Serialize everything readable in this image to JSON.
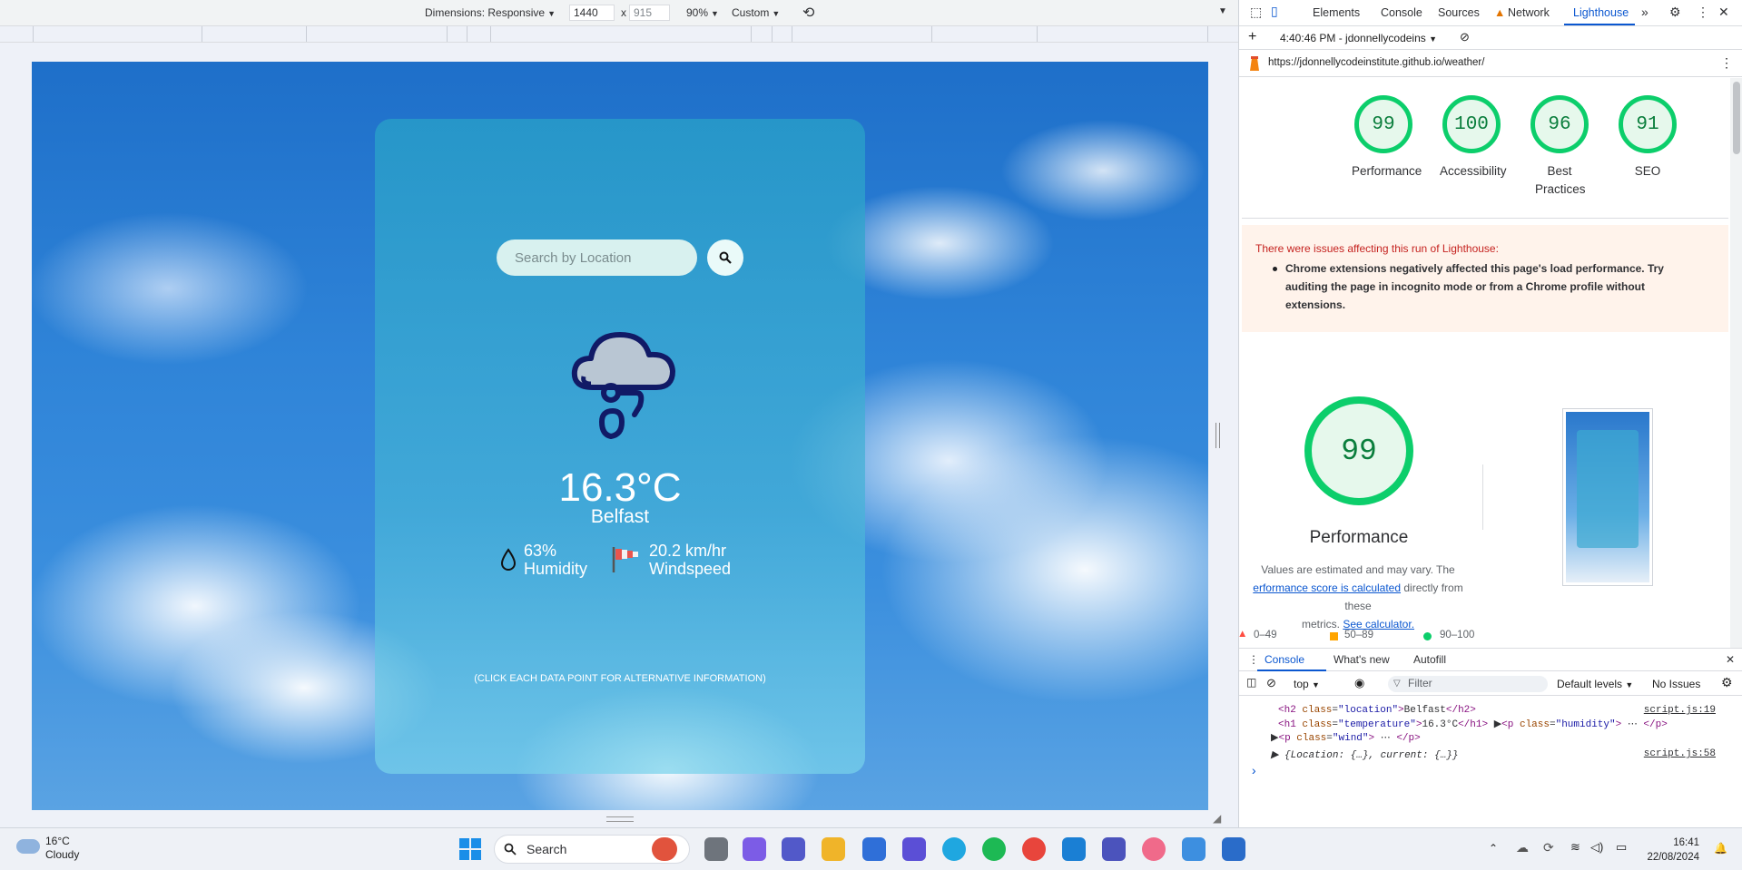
{
  "device_toolbar": {
    "dimensions_label": "Dimensions: Responsive",
    "width": "1440",
    "times": "x",
    "height": "915",
    "zoom": "90%",
    "throttle": "Custom"
  },
  "app": {
    "search_placeholder": "Search by Location",
    "temperature": "16.3°C",
    "location": "Belfast",
    "humidity_value": "63%",
    "humidity_label": "Humidity",
    "wind_value": "20.2 km/hr",
    "wind_label": "Windspeed",
    "hint": "(CLICK EACH DATA POINT FOR ALTERNATIVE INFORMATION)"
  },
  "devtools": {
    "tabs": [
      "Elements",
      "Console",
      "Sources",
      "Network",
      "Lighthouse"
    ],
    "report_time": "4:40:46 PM - jdonnellycodeins",
    "url": "https://jdonnellycodeinstitute.github.io/weather/",
    "scores": [
      {
        "value": "99",
        "label": "Performance"
      },
      {
        "value": "100",
        "label": "Accessibility"
      },
      {
        "value": "96",
        "label": "Best Practices"
      },
      {
        "value": "91",
        "label": "SEO"
      }
    ],
    "issues_heading": "There were issues affecting this run of Lighthouse:",
    "issues_item": "Chrome extensions negatively affected this page's load performance. Try auditing the page in incognito mode or from a Chrome profile without extensions.",
    "perf_score": "99",
    "perf_title": "Performance",
    "perf_note_1": "Values are estimated and may vary. The",
    "perf_note_link": "erformance score is calculated",
    "perf_note_2": "directly from these",
    "perf_note_3": "metrics.",
    "perf_note_link2": "See calculator.",
    "legend": [
      "0–49",
      "50–89",
      "90–100"
    ],
    "drawer_tabs": [
      "Console",
      "What's new",
      "Autofill"
    ],
    "context": "top",
    "filter_placeholder": "Filter",
    "levels": "Default levels",
    "no_issues": "No Issues",
    "console_lines": [
      {
        "text": "<h2 class=\"location\">Belfast</h2>",
        "src": "script.js:19"
      },
      {
        "text": "<h1 class=\"temperature\">16.3°C</h1>  ▶<p class=\"humidity\"> ⋯ </p>",
        "src": ""
      },
      {
        "text": "▶<p class=\"wind\"> ⋯ </p>",
        "src": ""
      },
      {
        "text": "▶ {Location: {…}, current: {…}}",
        "src": "script.js:58"
      }
    ],
    "prompt": "›"
  },
  "taskbar": {
    "weather_temp": "16°C",
    "weather_desc": "Cloudy",
    "search_label": "Search",
    "time": "16:41",
    "date": "22/08/2024"
  },
  "colors": {
    "good": "#0cce6b",
    "accent": "#0b57d0",
    "card": "#3aa9cf"
  }
}
